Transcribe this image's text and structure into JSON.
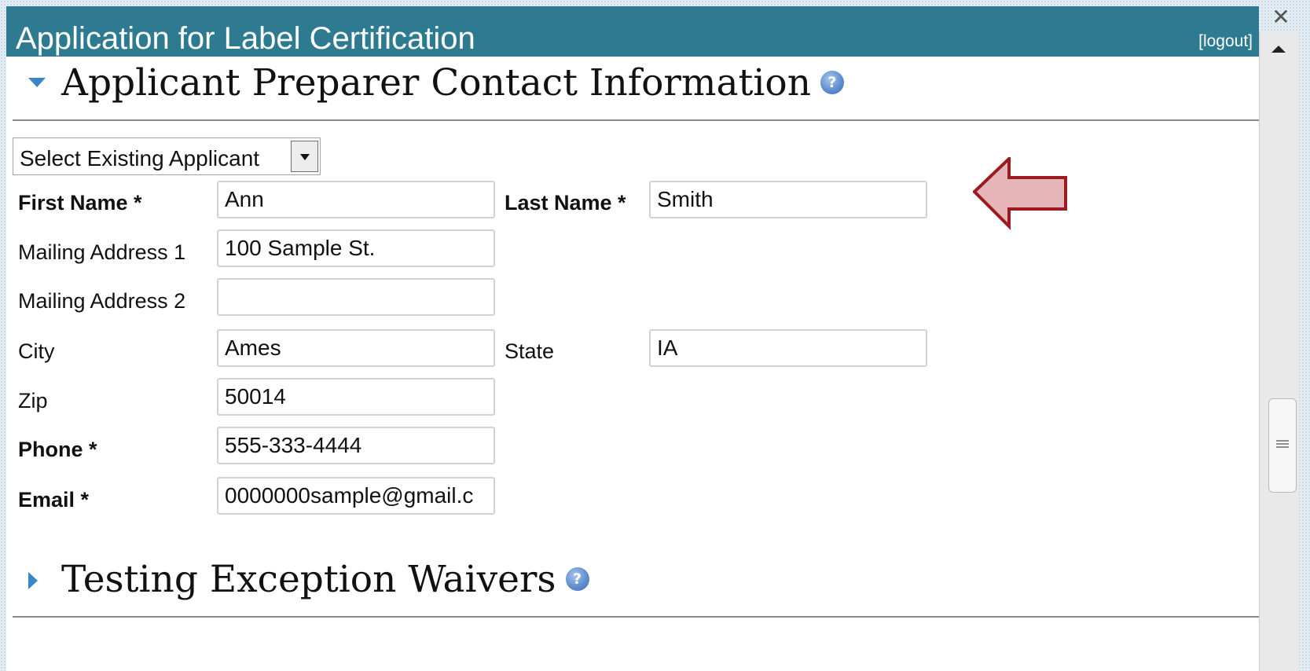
{
  "window": {
    "title": "Application for Label Certification",
    "logout_label": "[logout]",
    "close_glyph": "✕"
  },
  "colors": {
    "titlebar": "#2e7b91",
    "arrow_fill": "#e5b5b8",
    "arrow_stroke": "#9a1c22",
    "help_icon": "#5f8fd0"
  },
  "sections": {
    "applicant": {
      "heading": "Applicant Preparer Contact Information",
      "expanded": true,
      "icon": "help-icon"
    },
    "waivers": {
      "heading": "Testing Exception Waivers",
      "expanded": false,
      "icon": "help-icon"
    }
  },
  "form": {
    "select_applicant": {
      "value": "Select Existing Applicant"
    },
    "first_name": {
      "label": "First Name *",
      "value": "Ann"
    },
    "last_name": {
      "label": "Last Name *",
      "value": "Smith"
    },
    "mailing_address_1": {
      "label": "Mailing Address 1",
      "value": "100 Sample St."
    },
    "mailing_address_2": {
      "label": "Mailing Address 2",
      "value": ""
    },
    "city": {
      "label": "City",
      "value": "Ames"
    },
    "state": {
      "label": "State",
      "value": "IA"
    },
    "zip": {
      "label": "Zip",
      "value": "50014"
    },
    "phone": {
      "label": "Phone *",
      "value": "555-333-4444"
    },
    "email": {
      "label": "Email *",
      "value": "0000000sample@gmail.c"
    }
  },
  "help_glyph": "?"
}
